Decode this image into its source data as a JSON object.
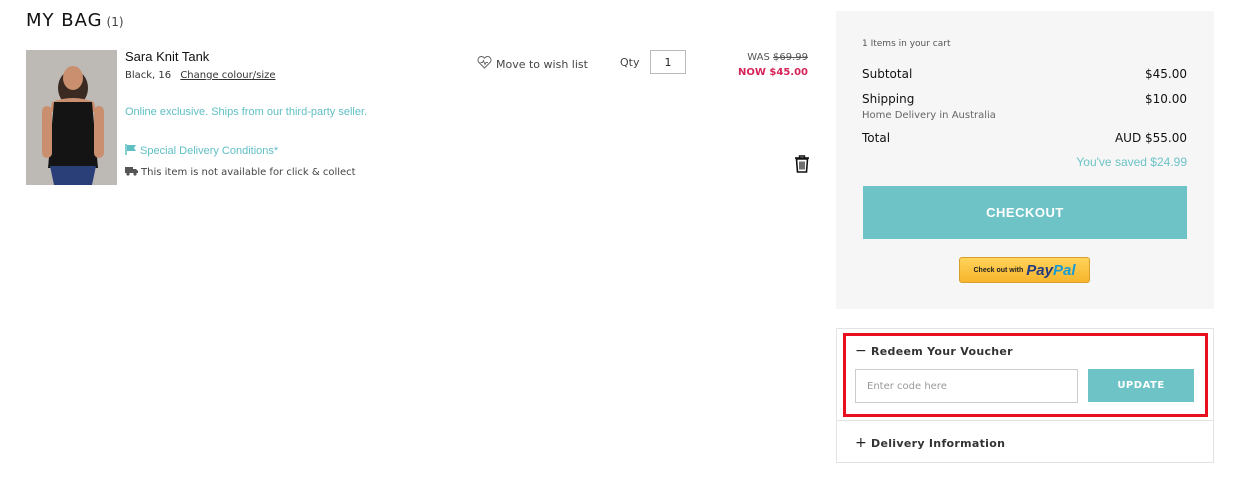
{
  "header": {
    "title": "MY BAG",
    "count": "(1)"
  },
  "product": {
    "name": "Sara Knit Tank",
    "variant": "Black, 16",
    "change_link": "Change colour/size",
    "online_note": "Online exclusive. Ships from our third-party seller.",
    "special_delivery": "Special Delivery Conditions*",
    "click_collect": "This item is not available for click & collect",
    "wish_label": "Move to wish list",
    "qty_label": "Qty",
    "qty_value": "1",
    "was_label": "WAS",
    "was_price": "$69.99",
    "now_price": "NOW $45.00"
  },
  "summary": {
    "items": "1 Items in your cart",
    "subtotal_label": "Subtotal",
    "subtotal_value": "$45.00",
    "shipping_label": "Shipping",
    "shipping_value": "$10.00",
    "shipping_note": "Home Delivery in Australia",
    "total_label": "Total",
    "total_value": "AUD $55.00",
    "saved": "You've saved $24.99",
    "checkout_label": "CHECKOUT",
    "paypal_prefix": "Check out with",
    "paypal_word_1": "Pay",
    "paypal_word_2": "Pal"
  },
  "voucher": {
    "toggle": "−",
    "title": "Redeem Your Voucher",
    "placeholder": "Enter code here",
    "button": "UPDATE"
  },
  "delivery": {
    "toggle": "+",
    "title": "Delivery Information"
  },
  "colors": {
    "accent": "#6dc3c6",
    "sale": "#d6245a",
    "highlight": "#e8101e"
  }
}
